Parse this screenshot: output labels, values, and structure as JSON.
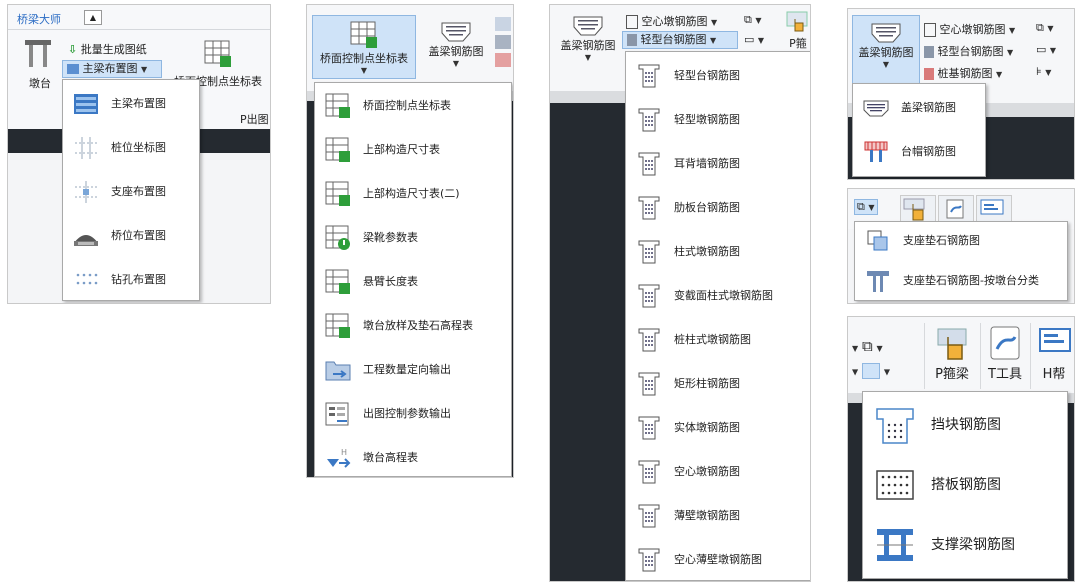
{
  "panel1": {
    "tab_label": "桥梁大师",
    "collapse_glyph": "▲",
    "pier_label": "墩台",
    "batch_label": "批量生成图纸",
    "main_girder_label": "主梁布置图",
    "control_label": "桥面控制点坐标表",
    "p_output_label": "P出图",
    "menu_items": [
      {
        "label": "主梁布置图"
      },
      {
        "label": "桩位坐标图"
      },
      {
        "label": "支座布置图"
      },
      {
        "label": "桥位布置图"
      },
      {
        "label": "钻孔布置图"
      }
    ]
  },
  "panel2": {
    "control_btn_label": "桥面控制点坐标表",
    "cap_beam_label": "盖梁钢筋图",
    "menu_items": [
      {
        "label": "桥面控制点坐标表"
      },
      {
        "label": "上部构造尺寸表"
      },
      {
        "label": "上部构造尺寸表(二)"
      },
      {
        "label": "梁靴参数表"
      },
      {
        "label": "悬臂长度表"
      },
      {
        "label": "墩台放样及垫石高程表"
      },
      {
        "label": "工程数量定向输出"
      },
      {
        "label": "出图控制参数输出"
      },
      {
        "label": "墩台高程表"
      }
    ]
  },
  "panel3": {
    "cap_beam_label": "盖梁钢筋图",
    "hollow_pier_label": "空心墩钢筋图",
    "light_abutment_label": "轻型台钢筋图",
    "p_label": "P箍",
    "menu_items": [
      {
        "label": "轻型台钢筋图"
      },
      {
        "label": "轻型墩钢筋图"
      },
      {
        "label": "耳背墙钢筋图"
      },
      {
        "label": "肋板台钢筋图"
      },
      {
        "label": "柱式墩钢筋图"
      },
      {
        "label": "变截面柱式墩钢筋图"
      },
      {
        "label": "桩柱式墩钢筋图"
      },
      {
        "label": "矩形柱钢筋图"
      },
      {
        "label": "实体墩钢筋图"
      },
      {
        "label": "空心墩钢筋图"
      },
      {
        "label": "薄壁墩钢筋图"
      },
      {
        "label": "空心薄壁墩钢筋图"
      }
    ]
  },
  "panel4": {
    "cap_beam_label": "盖梁钢筋图",
    "hollow_pier_label": "空心墩钢筋图",
    "light_abutment_label": "轻型台钢筋图",
    "pile_cap_label": "桩基钢筋图",
    "menu_items": [
      {
        "label": "盖梁钢筋图"
      },
      {
        "label": "台帽钢筋图"
      }
    ]
  },
  "panel5": {
    "menu_items": [
      {
        "label": "支座垫石钢筋图"
      },
      {
        "label": "支座垫石钢筋图-按墩台分类"
      }
    ]
  },
  "panel6": {
    "p_label": "P箍梁",
    "tools_label": "T工具",
    "help_label": "H帮",
    "menu_items": [
      {
        "label": "挡块钢筋图"
      },
      {
        "label": "搭板钢筋图"
      },
      {
        "label": "支撑梁钢筋图"
      }
    ]
  },
  "colors": {
    "accent_blue": "#2b6cc4",
    "icon_green": "#2e9e3a",
    "icon_blue": "#3b78c4",
    "dark_canvas": "#252a30",
    "selection": "#cfe3f8"
  }
}
